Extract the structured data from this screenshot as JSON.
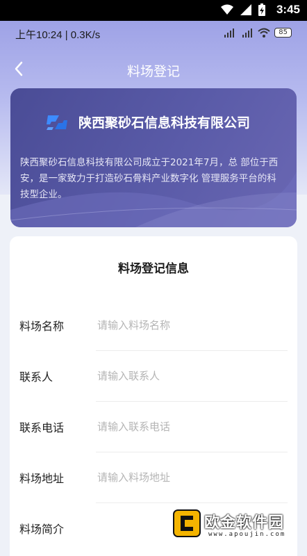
{
  "system_bar": {
    "time": "3:45"
  },
  "app_status": {
    "time_speed": "上午10:24 | 0.3K/s",
    "battery": "85"
  },
  "nav": {
    "title": "料场登记"
  },
  "company": {
    "name": "陕西聚砂石信息科技有限公司",
    "description": "陕西聚砂石信息科技有限公司成立于2021年7月，总 部位于西安，是一家致力于打造砂石骨料产业数字化 管理服务平台的科技型企业。"
  },
  "form": {
    "title": "料场登记信息",
    "fields": [
      {
        "label": "料场名称",
        "placeholder": "请输入料场名称"
      },
      {
        "label": "联系人",
        "placeholder": "请输入联系人"
      },
      {
        "label": "联系电话",
        "placeholder": "请输入联系电话"
      },
      {
        "label": "料场地址",
        "placeholder": "请输入料场地址"
      },
      {
        "label": "料场简介",
        "placeholder": ""
      }
    ]
  },
  "watermark": {
    "text": "欧金软件园",
    "url": "www.apoujin.com"
  },
  "colors": {
    "accent": "#5a5ba8",
    "brand_blue": "#2f7cf0"
  }
}
